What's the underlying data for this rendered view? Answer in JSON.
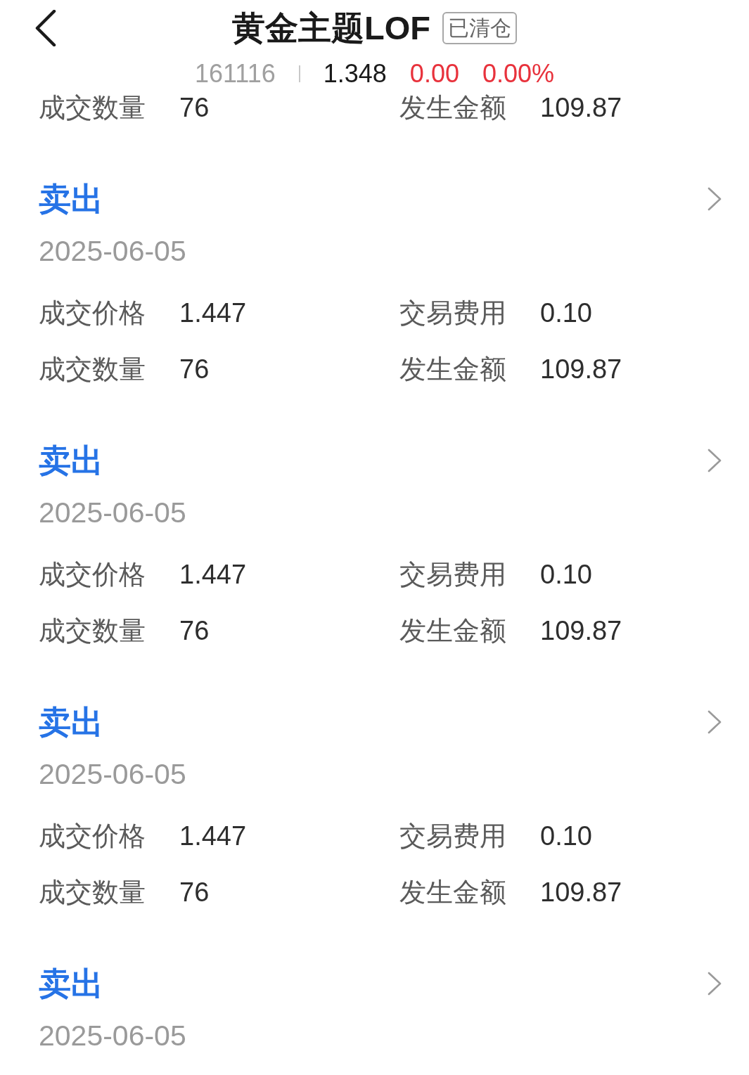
{
  "header": {
    "title": "黄金主题LOF",
    "badge": "已清仓",
    "code": "161116",
    "price": "1.348",
    "change": "0.00",
    "change_percent": "0.00%"
  },
  "records": [
    {
      "fields": [
        {
          "label": "成交数量",
          "value": "76"
        },
        {
          "label": "发生金额",
          "value": "109.87"
        }
      ]
    },
    {
      "type": "卖出",
      "date": "2025-06-05",
      "fields": [
        {
          "label": "成交价格",
          "value": "1.447"
        },
        {
          "label": "交易费用",
          "value": "0.10"
        },
        {
          "label": "成交数量",
          "value": "76"
        },
        {
          "label": "发生金额",
          "value": "109.87"
        }
      ]
    },
    {
      "type": "卖出",
      "date": "2025-06-05",
      "fields": [
        {
          "label": "成交价格",
          "value": "1.447"
        },
        {
          "label": "交易费用",
          "value": "0.10"
        },
        {
          "label": "成交数量",
          "value": "76"
        },
        {
          "label": "发生金额",
          "value": "109.87"
        }
      ]
    },
    {
      "type": "卖出",
      "date": "2025-06-05",
      "fields": [
        {
          "label": "成交价格",
          "value": "1.447"
        },
        {
          "label": "交易费用",
          "value": "0.10"
        },
        {
          "label": "成交数量",
          "value": "76"
        },
        {
          "label": "发生金额",
          "value": "109.87"
        }
      ]
    },
    {
      "type": "卖出",
      "date": "2025-06-05"
    }
  ]
}
